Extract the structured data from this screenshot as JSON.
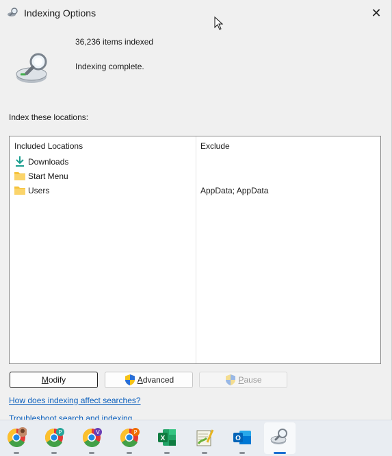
{
  "window": {
    "title": "Indexing Options",
    "close_glyph": "✕"
  },
  "status": {
    "items_indexed": "36,236 items indexed",
    "state": "Indexing complete."
  },
  "locations": {
    "label": "Index these locations:",
    "headers": {
      "included": "Included Locations",
      "exclude": "Exclude"
    },
    "rows": [
      {
        "name": "Downloads",
        "icon": "download-arrow-icon",
        "exclude": ""
      },
      {
        "name": "Start Menu",
        "icon": "folder-icon",
        "exclude": ""
      },
      {
        "name": "Users",
        "icon": "folder-icon",
        "exclude": "AppData; AppData"
      }
    ]
  },
  "buttons": {
    "modify_mnemonic": "M",
    "modify_rest": "odify",
    "advanced_mnemonic": "A",
    "advanced_rest": "dvanced",
    "pause_mnemonic": "P",
    "pause_rest": "ause"
  },
  "links": {
    "how_indexing_affects": "How does indexing affect searches?",
    "troubleshoot": "Troubleshoot search and indexing"
  },
  "taskbar": {
    "items": [
      {
        "name": "chrome-profile-photo-icon"
      },
      {
        "name": "chrome-profile-p-icon",
        "badge": "P"
      },
      {
        "name": "chrome-profile-v-icon",
        "badge": "V"
      },
      {
        "name": "chrome-profile-p2-icon",
        "badge": "P"
      },
      {
        "name": "excel-icon",
        "letter": "X"
      },
      {
        "name": "notepad-plus-icon"
      },
      {
        "name": "outlook-icon",
        "letter": "O"
      },
      {
        "name": "indexing-options-icon",
        "active": true
      }
    ]
  },
  "colors": {
    "link": "#0a5fbd",
    "folder": "#f5c23a",
    "download_arrow": "#1a9e8f",
    "taskbar_active": "#1a6fd1"
  }
}
